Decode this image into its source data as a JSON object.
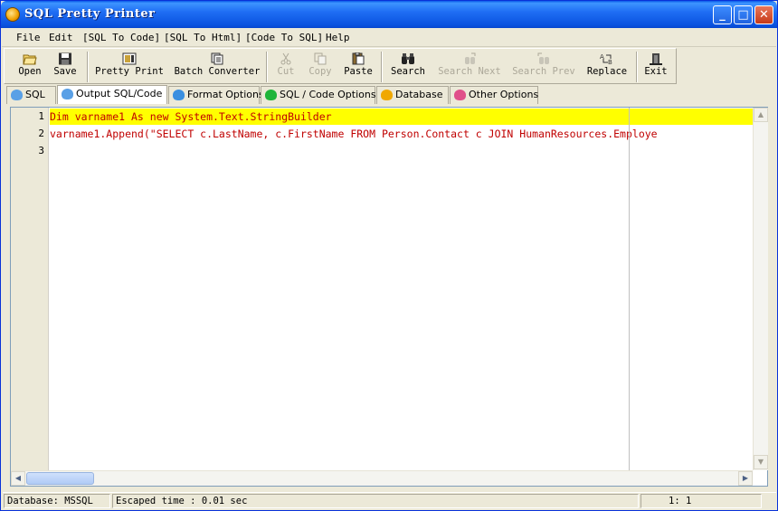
{
  "window": {
    "title": "SQL Pretty Printer"
  },
  "menu": [
    "File",
    "Edit",
    "[SQL To Code]",
    "[SQL To Html]",
    "[Code To SQL]",
    "Help"
  ],
  "toolbar": {
    "open": "Open",
    "save": "Save",
    "pretty_print": "Pretty Print",
    "batch_converter": "Batch Converter",
    "cut": "Cut",
    "copy": "Copy",
    "paste": "Paste",
    "search": "Search",
    "search_next": "Search Next",
    "search_prev": "Search Prev",
    "replace": "Replace",
    "exit": "Exit"
  },
  "tabs": [
    {
      "label": "SQL",
      "icon": "diamond-icon",
      "color": "#5aa0e6"
    },
    {
      "label": "Output SQL/Code",
      "icon": "diamond-icon",
      "color": "#5aa0e6"
    },
    {
      "label": "Format Options",
      "icon": "diamond-icon",
      "color": "#3a8fe0"
    },
    {
      "label": "SQL / Code Options",
      "icon": "diamond-icon",
      "color": "#1fb53a"
    },
    {
      "label": "Database",
      "icon": "diamond-icon",
      "color": "#f0a800"
    },
    {
      "label": "Other Options",
      "icon": "diamond-icon",
      "color": "#e0508a"
    }
  ],
  "editor": {
    "line_numbers": [
      "1",
      "2",
      "3"
    ],
    "lines": [
      "Dim  varname1 As new System.Text.StringBuilder",
      "varname1.Append(\"SELECT c.LastName, c.FirstName FROM Person.Contact c JOIN HumanResources.Employe",
      ""
    ]
  },
  "status": {
    "database": "Database: MSSQL",
    "escaped_time": "Escaped time : 0.01 sec",
    "position": "1:  1"
  },
  "colors": {
    "highlight": "#ffff00",
    "code_text": "#c00000",
    "title_bar": "#0b53e0"
  }
}
